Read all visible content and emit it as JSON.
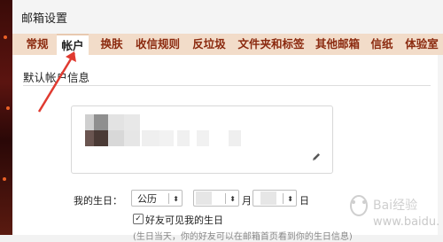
{
  "panel": {
    "title": "邮箱设置"
  },
  "tabs": [
    {
      "label": "常规",
      "active": false
    },
    {
      "label": "帐户",
      "active": true
    },
    {
      "label": "换肤",
      "active": false
    },
    {
      "label": "收信规则",
      "active": false
    },
    {
      "label": "反垃圾",
      "active": false
    },
    {
      "label": "文件夹和标签",
      "active": false
    },
    {
      "label": "其他邮箱",
      "active": false
    },
    {
      "label": "信纸",
      "active": false
    },
    {
      "label": "体验室",
      "active": false
    }
  ],
  "section": {
    "title": "默认帐户信息"
  },
  "birthday": {
    "label": "我的生日：",
    "calendar_value": "公历",
    "month_unit": "月",
    "day_unit": "日",
    "friends_visible_label": "好友可见我的生日",
    "friends_visible_checked": true
  },
  "note": "(生日当天，你的好友可以在邮箱首页看到你的生日信息)",
  "watermark": {
    "text": "www.baidu.com"
  },
  "colors": {
    "tab_bar": "#f2dcc9",
    "tab_text": "#8b2a0f",
    "annotation_arrow": "#e03a30"
  },
  "icons": {
    "edit": "pencil-icon",
    "select_arrow": "updown-arrow-icon",
    "checkbox": "check-icon"
  }
}
